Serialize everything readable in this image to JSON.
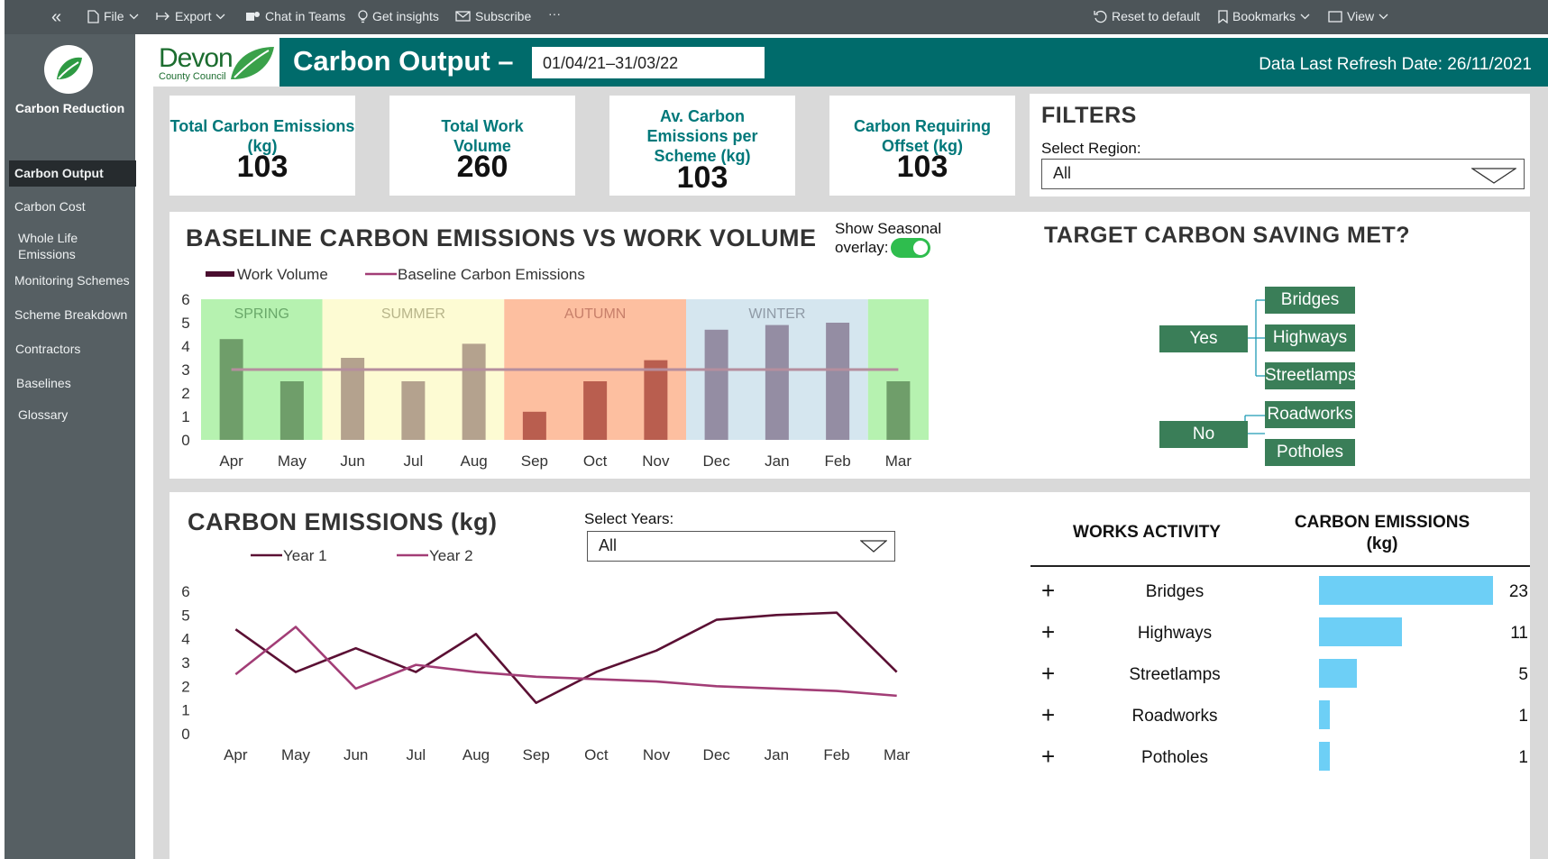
{
  "toolbar": {
    "file": "File",
    "export": "Export",
    "chat": "Chat in Teams",
    "insights": "Get insights",
    "subscribe": "Subscribe",
    "more": "···",
    "reset": "Reset to default",
    "bookmarks": "Bookmarks",
    "view": "View"
  },
  "sidebar": {
    "app_title": "Carbon Reduction",
    "items": [
      {
        "label": "Carbon Output",
        "active": true
      },
      {
        "label": "Carbon Cost"
      },
      {
        "label": "Whole Life Emissions"
      },
      {
        "label": "Monitoring Schemes"
      },
      {
        "label": "Scheme Breakdown"
      },
      {
        "label": "Contractors"
      },
      {
        "label": "Baselines"
      },
      {
        "label": "Glossary"
      }
    ]
  },
  "header": {
    "logo_name": "Devon",
    "logo_sub": "County Council",
    "title": "Carbon Output –",
    "date_range": "01/04/21–31/03/22",
    "refresh": "Data Last Refresh Date: 26/11/2021"
  },
  "kpis": [
    {
      "label": "Total Carbon Emissions (kg)",
      "value": "103"
    },
    {
      "label": "Total Work Volume",
      "value": "260"
    },
    {
      "label": "Av. Carbon Emissions per Scheme (kg)",
      "value": "103"
    },
    {
      "label": "Carbon Requiring Offset (kg)",
      "value": "103"
    }
  ],
  "filters": {
    "title": "FILTERS",
    "region_label": "Select Region:",
    "region_value": "All"
  },
  "baseline_chart": {
    "title": "BASELINE CARBON EMISSIONS VS WORK VOLUME",
    "toggle_label": "Show Seasonal overlay:",
    "toggle_on": true,
    "seasons": [
      "SPRING",
      "SUMMER",
      "AUTUMN",
      "WINTER"
    ]
  },
  "target": {
    "title": "TARGET CARBON SAVING MET?",
    "yes": "Yes",
    "no": "No",
    "yes_items": [
      "Bridges",
      "Highways",
      "Streetlamps"
    ],
    "no_items": [
      "Roadworks",
      "Potholes"
    ]
  },
  "emissions_chart": {
    "title": "CARBON EMISSIONS (kg)",
    "years_label": "Select Years:",
    "years_value": "All"
  },
  "works_table": {
    "col1": "WORKS ACTIVITY",
    "col2": "CARBON EMISSIONS (kg)",
    "rows": [
      {
        "name": "Bridges",
        "value": 23
      },
      {
        "name": "Highways",
        "value": 11
      },
      {
        "name": "Streetlamps",
        "value": 5
      },
      {
        "name": "Roadworks",
        "value": 1
      },
      {
        "name": "Potholes",
        "value": 1
      }
    ]
  },
  "colors": {
    "teal": "#006b6b",
    "spring": "#b6f2b0",
    "summer": "#fdfbd3",
    "autumn": "#fdbfa0",
    "winter": "#d5e6ef",
    "year1": "#5b1034",
    "year2": "#a23d76",
    "bar": "#6dcff6"
  },
  "chart_data": [
    {
      "type": "bar",
      "categories": [
        "Apr",
        "May",
        "Jun",
        "Jul",
        "Aug",
        "Sep",
        "Oct",
        "Nov",
        "Dec",
        "Jan",
        "Feb",
        "Mar"
      ],
      "series": [
        {
          "name": "Work Volume",
          "values": [
            4.3,
            2.5,
            3.5,
            2.5,
            4.1,
            1.2,
            2.5,
            3.4,
            4.7,
            4.9,
            5.0,
            2.5
          ]
        },
        {
          "name": "Baseline Carbon Emissions",
          "values": [
            3,
            3,
            3,
            3,
            3,
            3,
            3,
            3,
            3,
            3,
            3,
            3
          ]
        }
      ],
      "ylim": [
        0,
        6
      ],
      "yticks": [
        0,
        1,
        2,
        3,
        4,
        5,
        6
      ],
      "season_bands": [
        {
          "label": "SPRING",
          "from": 0,
          "to": 2
        },
        {
          "label": "SUMMER",
          "from": 2,
          "to": 5
        },
        {
          "label": "AUTUMN",
          "from": 5,
          "to": 8
        },
        {
          "label": "WINTER",
          "from": 8,
          "to": 11
        },
        {
          "label": "",
          "from": 11,
          "to": 12
        }
      ],
      "legend": "top-left"
    },
    {
      "type": "line",
      "categories": [
        "Apr",
        "May",
        "Jun",
        "Jul",
        "Aug",
        "Sep",
        "Oct",
        "Nov",
        "Dec",
        "Jan",
        "Feb",
        "Mar"
      ],
      "series": [
        {
          "name": "Year 1",
          "values": [
            4.4,
            2.6,
            3.6,
            2.6,
            4.2,
            1.3,
            2.6,
            3.5,
            4.8,
            5.0,
            5.1,
            2.6
          ]
        },
        {
          "name": "Year 2",
          "values": [
            2.5,
            4.5,
            1.9,
            2.9,
            2.6,
            2.4,
            2.3,
            2.2,
            2.0,
            1.9,
            1.8,
            1.6
          ]
        }
      ],
      "ylim": [
        0,
        6
      ],
      "yticks": [
        0,
        1,
        2,
        3,
        4,
        5,
        6
      ],
      "legend": "top-left"
    }
  ]
}
